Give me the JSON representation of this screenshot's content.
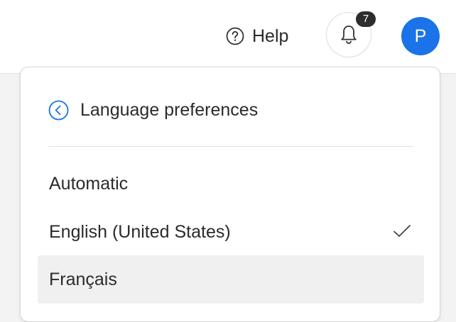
{
  "header": {
    "help_label": "Help",
    "notification_count": "7",
    "avatar_initial": "P"
  },
  "menu": {
    "title": "Language preferences",
    "options": [
      {
        "label": "Automatic",
        "selected": false,
        "highlighted": false
      },
      {
        "label": "English (United States)",
        "selected": true,
        "highlighted": false
      },
      {
        "label": "Français",
        "selected": false,
        "highlighted": true
      }
    ]
  },
  "icons": {
    "help": "help-circle-icon",
    "bell": "bell-icon",
    "back": "chevron-left-circle-icon",
    "check": "checkmark-icon"
  },
  "colors": {
    "accent": "#1a73e8",
    "badge": "#2d2d2d",
    "hover_row": "#f0f0f0"
  }
}
